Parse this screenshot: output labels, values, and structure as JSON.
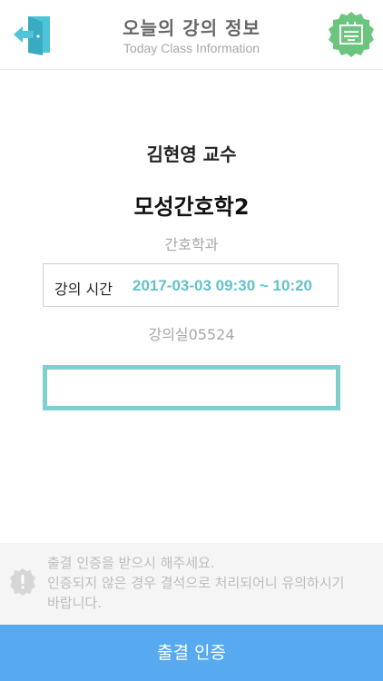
{
  "header": {
    "title": "오늘의 강의 정보",
    "subtitle": "Today Class Information",
    "left_icon": "exit-door-icon",
    "right_icon": "id-card-badge-icon"
  },
  "lecture": {
    "professor": "김현영 교수",
    "course": "모성간호학2",
    "department": "간호학과",
    "time_label": "강의 시간",
    "time_value": "2017-03-03 09:30 ~ 10:20",
    "room": "강의실05524"
  },
  "code_input": {
    "value": "",
    "placeholder": ""
  },
  "notice": {
    "icon": "alert-icon",
    "lines": [
      "출결 인증을 받으시 해주세요.",
      "인증되지 않은 경우 결석으로 처리되어니 유의하시기",
      "바랍니다."
    ]
  },
  "actions": {
    "attend_label": "출결 인증"
  },
  "colors": {
    "teal": "#63c1c8",
    "teal_border": "#7dcfd2",
    "blue": "#57aaf0",
    "badge_green": "#6cc57f",
    "exit_blue": "#4fc3d8"
  }
}
